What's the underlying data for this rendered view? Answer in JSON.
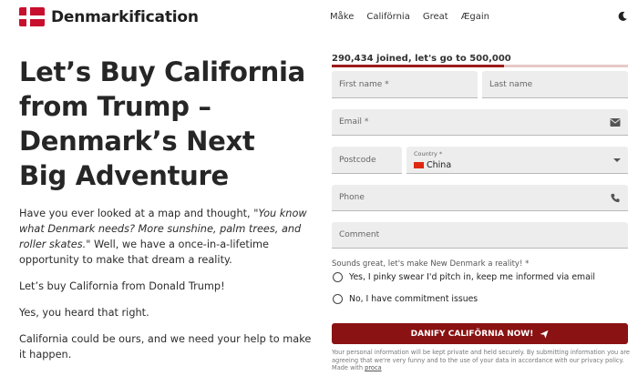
{
  "header": {
    "brand": "Denmarkification",
    "nav": [
      "Måke",
      "Califörnia",
      "Great",
      "Ægain"
    ],
    "theme_icon": "moon-icon"
  },
  "hero": {
    "title": "Let’s Buy California from Trump – Denmark’s Next Big Adventure"
  },
  "copy": {
    "p1_start": "Have you ever looked at a map and thought, ",
    "p1_quote": "\"You know what Denmark needs? More sunshine, palm trees, and roller skates.\"",
    "p1_end": " Well, we have a once-in-a-lifetime opportunity to make that dream a reality.",
    "p2": "Let’s buy California from Donald Trump!",
    "p3": "Yes, you heard that right.",
    "p4": "California could be ours, and we need your help to make it happen."
  },
  "progress": {
    "text": "290,434 joined, let's go to 500,000",
    "fraction": 0.5809
  },
  "form": {
    "first_name": "First name *",
    "last_name": "Last name",
    "email": "Email *",
    "postcode": "Postcode",
    "country_label": "Country *",
    "country_value": "China",
    "phone": "Phone",
    "comment": "Comment",
    "consent_question": "Sounds great, let's make New Denmark a reality! *",
    "option_yes": "Yes, I pinky swear I'd pitch in, keep me informed via email",
    "option_no": "No, I have commitment issues",
    "submit": "DANIFY CALIFÖRNIA NOW!",
    "fine_print": "Your personal information will be kept private and held securely. By submitting information you are agreeing that we're very funny and to the use of your data in accordance with our privacy policy. Made with ",
    "fine_link": "proca"
  },
  "colors": {
    "accent": "#8a1212",
    "flag_red": "#c8102e",
    "field_bg": "#ededed"
  }
}
